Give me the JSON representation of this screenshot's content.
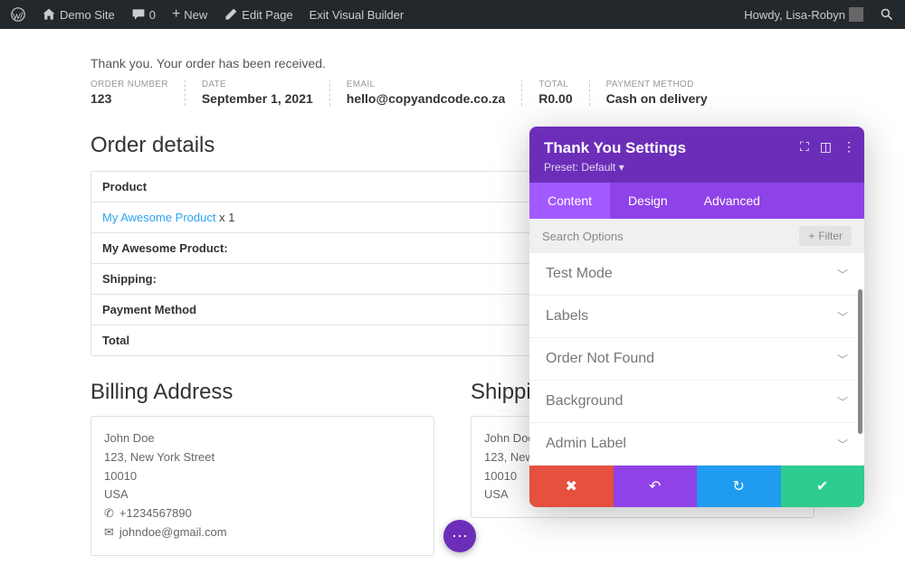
{
  "adminbar": {
    "site": "Demo Site",
    "comments": "0",
    "new": "New",
    "edit": "Edit Page",
    "exit": "Exit Visual Builder",
    "greeting": "Howdy, Lisa-Robyn"
  },
  "thank": "Thank you. Your order has been received.",
  "meta": {
    "order_label": "ORDER NUMBER",
    "order": "123",
    "date_label": "DATE",
    "date": "September 1, 2021",
    "email_label": "EMAIL",
    "email": "hello@copyandcode.co.za",
    "total_label": "TOTAL",
    "total": "R0.00",
    "pm_label": "PAYMENT METHOD",
    "pm": "Cash on delivery"
  },
  "details": {
    "heading": "Order details",
    "header": "Product",
    "product_link": "My Awesome Product",
    "product_qty": " x 1",
    "row1": "My Awesome Product:",
    "row2": "Shipping:",
    "row3": "Payment Method",
    "row4": "Total"
  },
  "billing": {
    "heading": "Billing Address",
    "name": "John Doe",
    "street": "123, New York Street",
    "zip": "10010",
    "country": "USA",
    "phone": "+1234567890",
    "email": "johndoe@gmail.com"
  },
  "shipping": {
    "heading": "Shipping Address",
    "name": "John Doe",
    "street": "123, New York Street",
    "zip": "10010",
    "country": "USA"
  },
  "panel": {
    "title": "Thank You Settings",
    "preset": "Preset: Default ▾",
    "tabs": {
      "content": "Content",
      "design": "Design",
      "advanced": "Advanced"
    },
    "search": "Search Options",
    "filter": "Filter",
    "opts": [
      "Test Mode",
      "Labels",
      "Order Not Found",
      "Background",
      "Admin Label"
    ]
  }
}
